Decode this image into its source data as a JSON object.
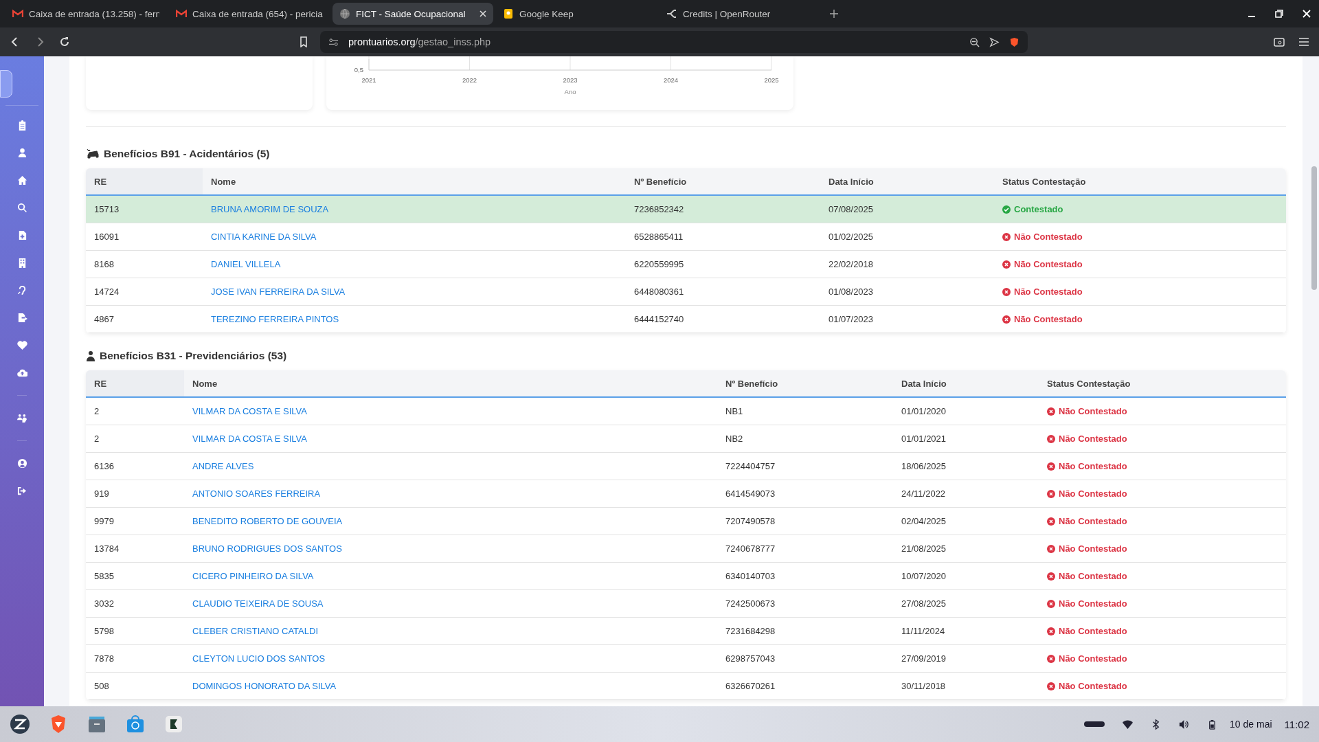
{
  "tabs": [
    {
      "title": "Caixa de entrada (13.258) - fern",
      "kind": "mail",
      "selected": false
    },
    {
      "title": "Caixa de entrada (654) - pericia",
      "kind": "mail",
      "selected": false
    },
    {
      "title": "FICT - Saúde Ocupacional",
      "kind": "globe",
      "selected": true
    },
    {
      "title": "Google Keep",
      "kind": "keep",
      "selected": false
    },
    {
      "title": "Credits | OpenRouter",
      "kind": "router",
      "selected": false
    }
  ],
  "address": {
    "host": "prontuarios.org",
    "path": "/gestao_inss.php"
  },
  "chart": {
    "yticks": [
      "0,5"
    ],
    "xticks": [
      "2021",
      "2022",
      "2023",
      "2024",
      "2025"
    ],
    "xlabel": "Ano"
  },
  "sections": [
    {
      "title": "Benefícios B91 - Acidentários (5)",
      "columns": [
        "RE",
        "Nome",
        "Nº Benefício",
        "Data Início",
        "Status Contestação"
      ],
      "rows": [
        {
          "re": "15713",
          "name": "BRUNA AMORIM DE SOUZA",
          "benefit": "7236852342",
          "date": "07/08/2025",
          "status": "Contestado",
          "contested": true
        },
        {
          "re": "16091",
          "name": "CINTIA KARINE DA SILVA",
          "benefit": "6528865411",
          "date": "01/02/2025",
          "status": "Não Contestado",
          "contested": false
        },
        {
          "re": "8168",
          "name": "DANIEL VILLELA",
          "benefit": "6220559995",
          "date": "22/02/2018",
          "status": "Não Contestado",
          "contested": false
        },
        {
          "re": "14724",
          "name": "JOSE IVAN FERREIRA DA SILVA",
          "benefit": "6448080361",
          "date": "01/08/2023",
          "status": "Não Contestado",
          "contested": false
        },
        {
          "re": "4867",
          "name": "TEREZINO FERREIRA PINTOS",
          "benefit": "6444152740",
          "date": "01/07/2023",
          "status": "Não Contestado",
          "contested": false
        }
      ]
    },
    {
      "title": "Benefícios B31 - Previdenciários (53)",
      "columns": [
        "RE",
        "Nome",
        "Nº Benefício",
        "Data Início",
        "Status Contestação"
      ],
      "rows": [
        {
          "re": "2",
          "name": "VILMAR DA COSTA E SILVA",
          "benefit": "NB1",
          "date": "01/01/2020",
          "status": "Não Contestado",
          "contested": false
        },
        {
          "re": "2",
          "name": "VILMAR DA COSTA E SILVA",
          "benefit": "NB2",
          "date": "01/01/2021",
          "status": "Não Contestado",
          "contested": false
        },
        {
          "re": "6136",
          "name": "ANDRE ALVES",
          "benefit": "7224404757",
          "date": "18/06/2025",
          "status": "Não Contestado",
          "contested": false
        },
        {
          "re": "919",
          "name": "ANTONIO SOARES FERREIRA",
          "benefit": "6414549073",
          "date": "24/11/2022",
          "status": "Não Contestado",
          "contested": false
        },
        {
          "re": "9979",
          "name": "BENEDITO ROBERTO DE GOUVEIA",
          "benefit": "7207490578",
          "date": "02/04/2025",
          "status": "Não Contestado",
          "contested": false
        },
        {
          "re": "13784",
          "name": "BRUNO RODRIGUES DOS SANTOS",
          "benefit": "7240678777",
          "date": "21/08/2025",
          "status": "Não Contestado",
          "contested": false
        },
        {
          "re": "5835",
          "name": "CICERO PINHEIRO DA SILVA",
          "benefit": "6340140703",
          "date": "10/07/2020",
          "status": "Não Contestado",
          "contested": false
        },
        {
          "re": "3032",
          "name": "CLAUDIO TEIXEIRA DE SOUSA",
          "benefit": "7242500673",
          "date": "27/08/2025",
          "status": "Não Contestado",
          "contested": false
        },
        {
          "re": "5798",
          "name": "CLEBER CRISTIANO CATALDI",
          "benefit": "7231684298",
          "date": "11/11/2024",
          "status": "Não Contestado",
          "contested": false
        },
        {
          "re": "7878",
          "name": "CLEYTON LUCIO DOS SANTOS",
          "benefit": "6298757043",
          "date": "27/09/2019",
          "status": "Não Contestado",
          "contested": false
        },
        {
          "re": "508",
          "name": "DOMINGOS HONORATO DA SILVA",
          "benefit": "6326670261",
          "date": "30/11/2018",
          "status": "Não Contestado",
          "contested": false
        }
      ]
    }
  ],
  "taskbar": {
    "date": "10 de mai",
    "time": "11:02"
  }
}
